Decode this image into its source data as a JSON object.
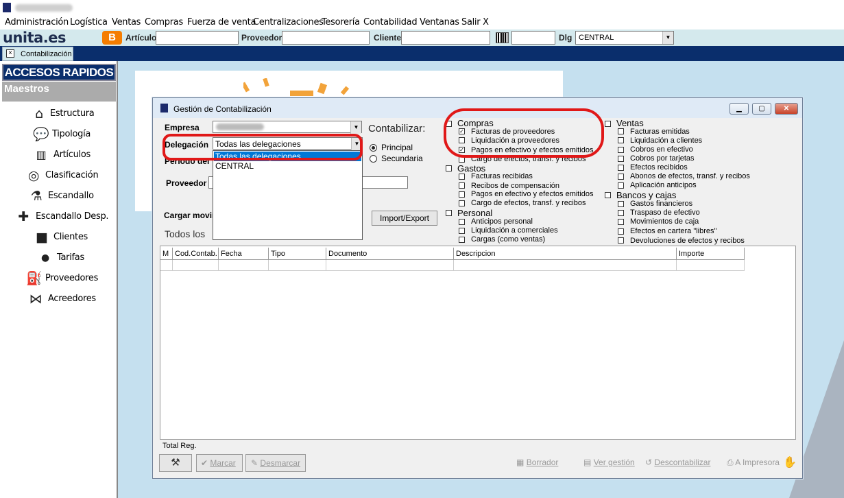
{
  "menu": [
    "Administración",
    "Logística",
    "Ventas",
    "Compras",
    "Fuerza de venta",
    "Centralizaciones",
    "Tesorería",
    "Contabilidad",
    "Ventanas",
    "Salir X"
  ],
  "toolbar": {
    "logo": "unita.es",
    "blogger_glyph": "B",
    "articulo_label": "Artículo",
    "proveedor_label": "Proveedor",
    "cliente_label": "Cliente",
    "dlg_label": "Dlg",
    "dlg_value": "CENTRAL"
  },
  "tab": {
    "label": "Contabilización"
  },
  "sidebar": {
    "header": "ACCESOS RAPIDOS",
    "section": "Maestros",
    "items": [
      {
        "label": "Estructura",
        "icon": "house-icon"
      },
      {
        "label": "Tipología",
        "icon": "speech-bubbles-icon"
      },
      {
        "label": "Artículos",
        "icon": "barcode-icon"
      },
      {
        "label": "Clasificación",
        "icon": "compass-icon"
      },
      {
        "label": "Escandallo",
        "icon": "flask-icon"
      },
      {
        "label": "Escandallo Desp.",
        "icon": "puzzle-icon"
      },
      {
        "label": "Clientes",
        "icon": "briefcase-icon"
      },
      {
        "label": "Tarifas",
        "icon": "price-tag-icon"
      },
      {
        "label": "Proveedores",
        "icon": "fuel-pump-icon"
      },
      {
        "label": "Acreedores",
        "icon": "bow-tie-icon"
      }
    ]
  },
  "dialog": {
    "title": "Gestión de Contabilización",
    "empresa_label": "Empresa",
    "delegacion_label": "Delegación",
    "delegacion_value": "Todas las delegaciones",
    "delegacion_options": [
      "Todas las delegaciones",
      "CENTRAL"
    ],
    "periodo_label_partial": "Periodo del",
    "proveedor_label": "Proveedor",
    "cargar_label_partial": "Cargar movim",
    "todos_label_partial": "Todos los",
    "contabilizar_label": "Contabilizar:",
    "principal_label": "Principal",
    "secundaria_label": "Secundaria",
    "import_export": "Import/Export",
    "groups": {
      "compras": {
        "label": "Compras",
        "options": [
          {
            "label": "Facturas de proveedores",
            "checked": true
          },
          {
            "label": "Liquidación a proveedores",
            "checked": false
          },
          {
            "label": "Pagos en efectivo y efectos emitidos",
            "checked": true
          },
          {
            "label": "Cargo de efectos, transf. y recibos",
            "checked": false
          }
        ]
      },
      "gastos": {
        "label": "Gastos",
        "options": [
          {
            "label": "Facturas recibidas",
            "checked": false
          },
          {
            "label": "Recibos de compensación",
            "checked": false
          },
          {
            "label": "Pagos en efectivo y efectos emitidos",
            "checked": false
          },
          {
            "label": "Cargo de efectos, transf. y recibos",
            "checked": false
          }
        ]
      },
      "personal": {
        "label": "Personal",
        "options": [
          {
            "label": "Anticipos personal",
            "checked": false
          },
          {
            "label": "Liquidación a comerciales",
            "checked": false
          },
          {
            "label": "Cargas (como ventas)",
            "checked": false
          }
        ]
      },
      "ventas": {
        "label": "Ventas",
        "options": [
          {
            "label": "Facturas emitidas",
            "checked": false
          },
          {
            "label": "Liquidación a clientes",
            "checked": false
          },
          {
            "label": "Cobros en efectivo",
            "checked": false
          },
          {
            "label": "Cobros por tarjetas",
            "checked": false
          },
          {
            "label": "Efectos recibidos",
            "checked": false
          },
          {
            "label": "Abonos de efectos, transf. y recibos",
            "checked": false
          },
          {
            "label": "Aplicación anticipos",
            "checked": false
          }
        ]
      },
      "bancos": {
        "label": "Bancos y cajas",
        "options": [
          {
            "label": "Gastos financieros",
            "checked": false
          },
          {
            "label": "Traspaso de efectivo",
            "checked": false
          },
          {
            "label": "Movimientos de caja",
            "checked": false
          },
          {
            "label": "Efectos en cartera \"libres\"",
            "checked": false
          },
          {
            "label": "Devoluciones de efectos y recibos",
            "checked": false
          }
        ]
      }
    },
    "grid_headers": [
      "M",
      "Cod.Contab.",
      "Fecha",
      "Tipo",
      "Documento",
      "Descripcion",
      "Importe"
    ],
    "total_label": "Total Reg.",
    "buttons": {
      "marcar": "Marcar",
      "desmarcar": "Desmarcar",
      "borrador": "Borrador",
      "ver_gestion": "Ver gestión",
      "descontabilizar": "Descontabilizar",
      "impresora": "A Impresora"
    }
  },
  "colors": {
    "highlight_ring": "#e01818",
    "nav_dark": "#0a2e6c",
    "toolbar_bg": "#d4e9ed",
    "desktop_bg": "#c5e0ef"
  }
}
